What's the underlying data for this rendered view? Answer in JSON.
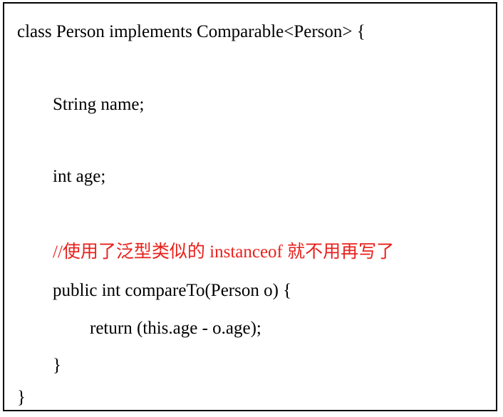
{
  "code": {
    "lines": [
      {
        "text": "class Person implements Comparable<Person> {",
        "kind": "code"
      },
      {
        "text": "String name;",
        "kind": "code"
      },
      {
        "text": "int age;",
        "kind": "code"
      },
      {
        "text": "//使用了泛型类似的 instanceof 就不用再写了",
        "kind": "comment"
      },
      {
        "text": "public int compareTo(Person o) {",
        "kind": "code"
      },
      {
        "text": "return (this.age - o.age);",
        "kind": "code"
      },
      {
        "text": "}",
        "kind": "code"
      },
      {
        "text": "}",
        "kind": "code"
      }
    ]
  },
  "colors": {
    "text": "#000000",
    "comment": "#e8211c",
    "border": "#000000",
    "background": "#ffffff"
  }
}
